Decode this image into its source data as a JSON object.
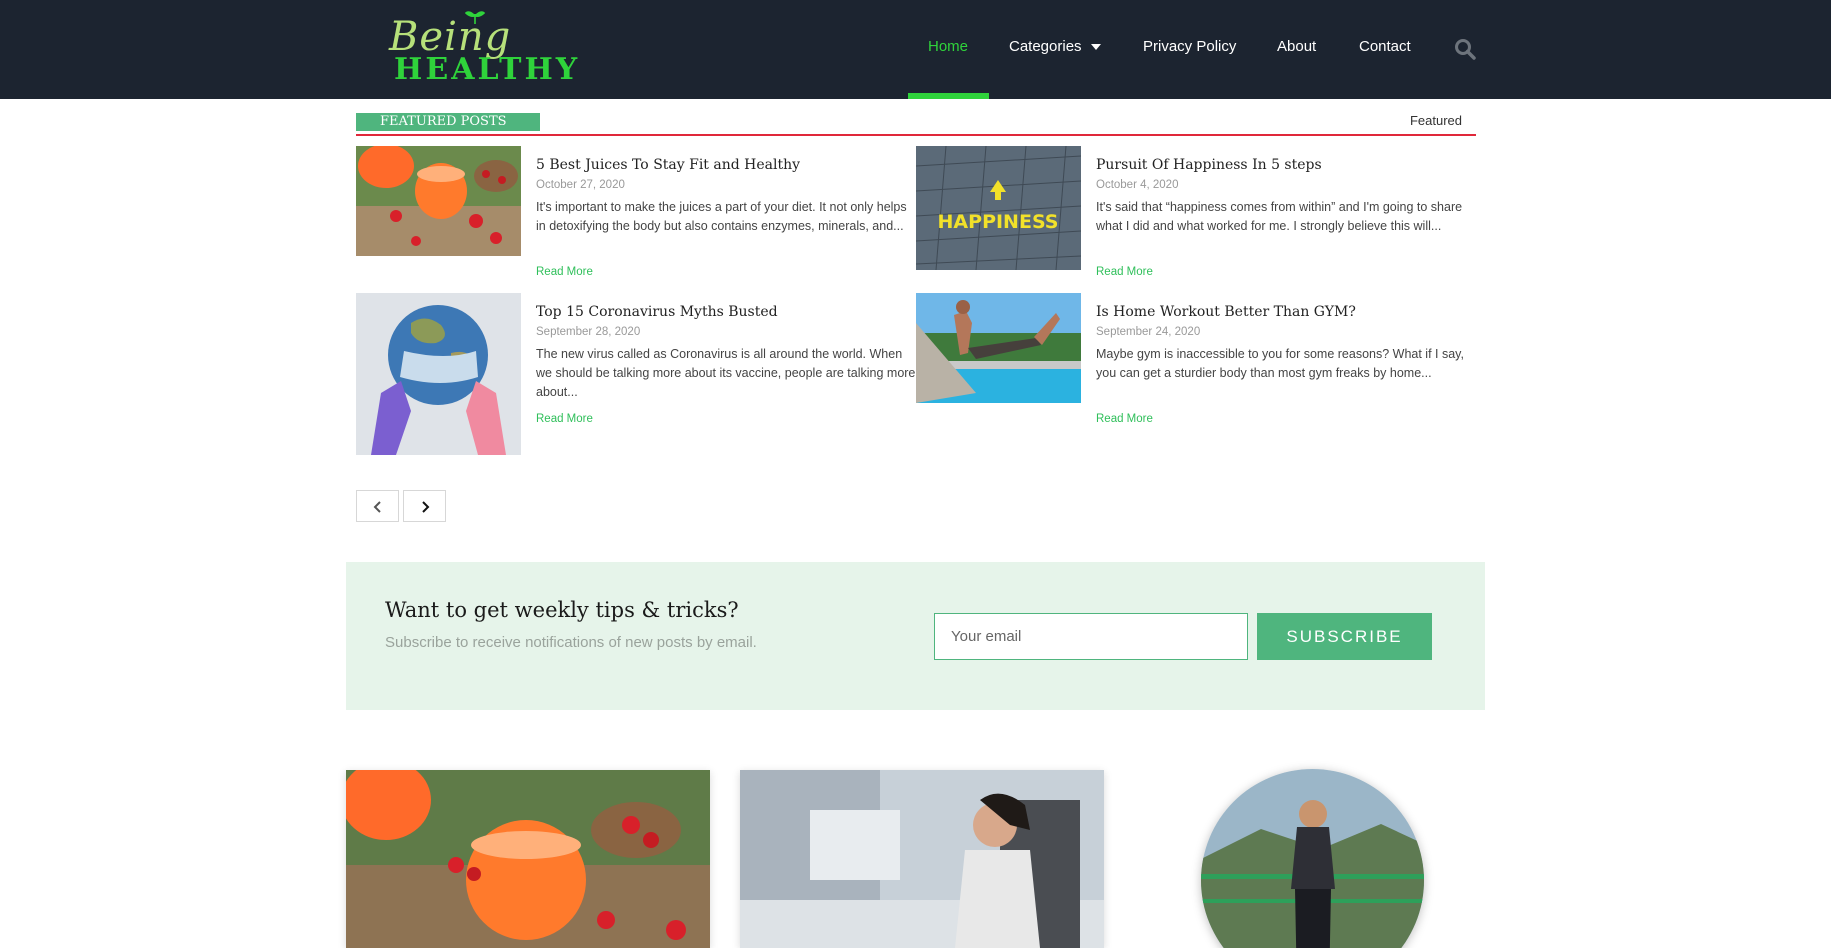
{
  "header": {
    "logo_line1": "Being",
    "logo_line2": "HEALTHY",
    "nav": [
      {
        "label": "Home",
        "active": true
      },
      {
        "label": "Categories",
        "dropdown": true
      },
      {
        "label": "Privacy Policy"
      },
      {
        "label": "About"
      },
      {
        "label": "Contact"
      }
    ],
    "search_icon": "search-icon"
  },
  "featured": {
    "label": "FEATURED POSTS",
    "filter": "Featured"
  },
  "posts": [
    {
      "title": "5 Best Juices To Stay Fit and Healthy",
      "date": "October 27, 2020",
      "excerpt": "It's important to make the juices a part of your diet. It not only helps in detoxifying the body but also contains enzymes, minerals, and...",
      "more": "Read More"
    },
    {
      "title": "Pursuit Of Happiness In 5 steps",
      "date": "October 4, 2020",
      "excerpt": "It's said that “happiness comes from within” and I'm going to share what I did and what worked for me. I strongly believe this will...",
      "more": "Read More",
      "image_text": "HAPPINESS"
    },
    {
      "title": "Top 15 Coronavirus Myths Busted",
      "date": "September 28, 2020",
      "excerpt": "The new virus called as Coronavirus is all around the world. When we should be talking more about its vaccine, people are talking more about...",
      "more": "Read More"
    },
    {
      "title": "Is Home Workout Better Than GYM?",
      "date": "September 24, 2020",
      "excerpt": "Maybe gym is inaccessible to you for some reasons? What if I say, you can get a sturdier body than most gym freaks by home...",
      "more": "Read More"
    }
  ],
  "pager": {
    "prev_icon": "chevron-left-icon",
    "next_icon": "chevron-right-icon"
  },
  "subscribe": {
    "title": "Want to get weekly tips & tricks?",
    "text": "Subscribe to  receive notifications of new posts by email.",
    "placeholder": "Your email",
    "button": "SUBSCRIBE"
  },
  "colors": {
    "header_bg": "#1c2430",
    "accent_green": "#2fd33b",
    "button_green": "#4fb57e",
    "featured_line": "#e0283a",
    "subscribe_bg": "#e6f4ea"
  }
}
